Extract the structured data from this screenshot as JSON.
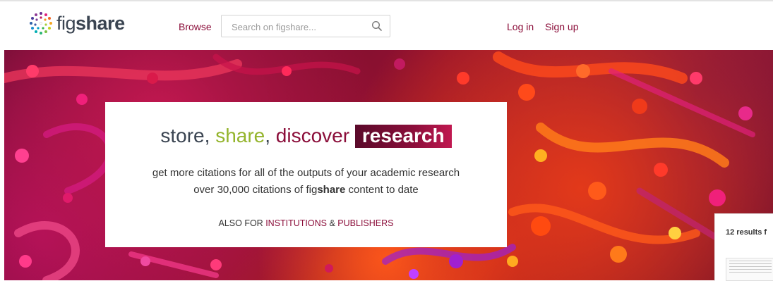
{
  "header": {
    "logo_prefix": "fig",
    "logo_bold": "share",
    "browse_label": "Browse",
    "search_placeholder": "Search on figshare...",
    "login_label": "Log in",
    "signup_label": "Sign up"
  },
  "hero": {
    "tagline": {
      "store": "store,",
      "share": "share",
      "comma": ",",
      "discover": "discover",
      "research": "research"
    },
    "line1": "get more citations for all of the outputs of your academic research",
    "line2_prefix": "over 30,000 citations of fig",
    "line2_bold": "share",
    "line2_suffix": " content to date",
    "also_prefix": "ALSO FOR ",
    "institutions": "INSTITUTIONS",
    "amp": " & ",
    "publishers": "PUBLISHERS"
  },
  "side_panel": {
    "results_text": "12 results f"
  },
  "colors": {
    "brand": "#8b0e3a",
    "share_green": "#94b42c",
    "text_dark": "#3a4451"
  }
}
